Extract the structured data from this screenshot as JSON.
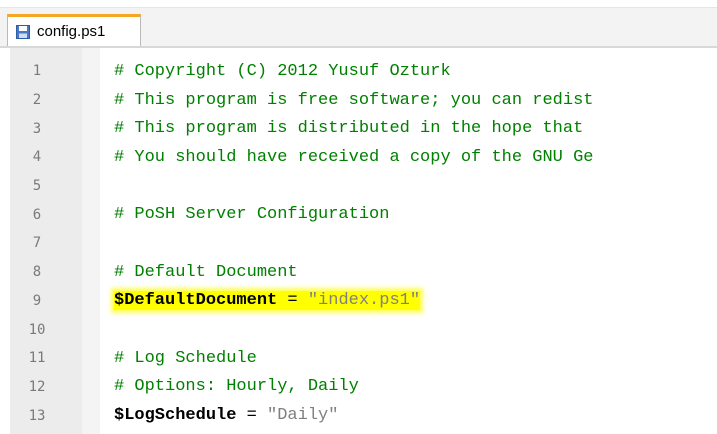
{
  "tab": {
    "label": "config.ps1",
    "icon": "save-icon"
  },
  "colors": {
    "accent": "#f5a623",
    "comment": "#008000",
    "string": "#808080",
    "highlight": "#ffff00"
  },
  "lines": [
    {
      "num": "1",
      "text": "# Copyright (C) 2012 Yusuf Ozturk"
    },
    {
      "num": "2",
      "text": "# This program is free software; you can redist"
    },
    {
      "num": "3",
      "text": "# This program is distributed in the hope that"
    },
    {
      "num": "4",
      "text": "# You should have received a copy of the GNU Ge"
    },
    {
      "num": "5",
      "text": ""
    },
    {
      "num": "6",
      "text": "# PoSH Server Configuration"
    },
    {
      "num": "7",
      "text": ""
    },
    {
      "num": "8",
      "text": "# Default Document"
    },
    {
      "num": "9",
      "var": "$DefaultDocument",
      "op": " = ",
      "str": "\"index.ps1\""
    },
    {
      "num": "10",
      "text": ""
    },
    {
      "num": "11",
      "text": "# Log Schedule"
    },
    {
      "num": "12",
      "text": "# Options: Hourly, Daily"
    },
    {
      "num": "13",
      "var": "$LogSchedule",
      "op": " = ",
      "str": "\"Daily\""
    }
  ]
}
